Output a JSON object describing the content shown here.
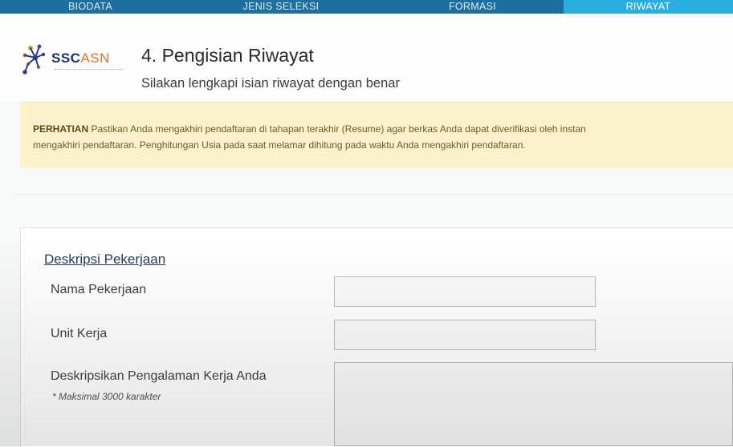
{
  "steps": [
    {
      "label": "BIODATA",
      "active": false
    },
    {
      "label": "JENIS SELEKSI",
      "active": false
    },
    {
      "label": "FORMASI",
      "active": false
    },
    {
      "label": "RIWAYAT",
      "active": true
    }
  ],
  "logo": {
    "text_main": "SSC",
    "text_accent": "ASN",
    "icon": "sscasn-logo-icon"
  },
  "header": {
    "title": "4. Pengisian Riwayat",
    "subtitle": "Silakan lengkapi isian riwayat dengan benar"
  },
  "alert": {
    "strong": "PERHATIAN",
    "line1": " Pastikan Anda mengakhiri pendaftaran di tahapan terakhir (Resume) agar berkas Anda dapat diverifikasi oleh instan",
    "line2": "mengakhiri pendaftaran. Penghitungan Usia pada saat melamar dihitung pada waktu Anda mengakhiri pendaftaran."
  },
  "section": {
    "title": "Deskripsi Pekerjaan",
    "fields": {
      "nama_pekerjaan": {
        "label": "Nama Pekerjaan",
        "value": ""
      },
      "unit_kerja": {
        "label": "Unit Kerja",
        "value": ""
      },
      "deskripsi": {
        "label": "Deskripsikan Pengalaman Kerja Anda",
        "note": "* Maksimal 3000 karakter",
        "value": ""
      }
    }
  },
  "colors": {
    "stepbar": "#1c6f9e",
    "step_active": "#29aee0",
    "alert_bg": "#fcf1cd",
    "logo_navy": "#1a2f6e",
    "logo_orange": "#e0702b"
  }
}
